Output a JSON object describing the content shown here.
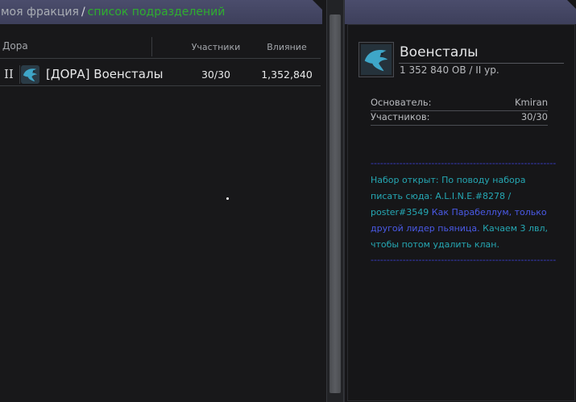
{
  "breadcrumb": {
    "faction": "моя фракция",
    "separator": "/",
    "current": "список подразделений"
  },
  "table": {
    "columns": {
      "name": "Дора",
      "members": "Участники",
      "influence": "Влияние"
    },
    "rows": [
      {
        "rank": "II",
        "emblem": "eagle-emblem",
        "name": "[ДОРА] Военсталы",
        "members": "30/30",
        "influence": "1,352,840"
      }
    ]
  },
  "clan": {
    "name": "Военсталы",
    "subtitle": "1 352 840 ОВ / II ур.",
    "emblem": "eagle-emblem",
    "founder_label": "Основатель:",
    "founder_value": "Kmiran",
    "members_label": "Участников:",
    "members_value": "30/30",
    "description": {
      "separator": "----------------------------------------------------------",
      "line1": "Набор открыт: По поводу набора",
      "line2": "писать сюда: A.L.I.N.E.#8278 /",
      "line3_part1": "poster#3549 ",
      "line3_part2": "Как Парабеллум, только",
      "line4_part1": "другой лидер пьяница. ",
      "line4_part2": "Качаем 3 лвл,",
      "line5": "чтобы потом удалить клан."
    }
  },
  "colors": {
    "header_bg": "#45475f",
    "breadcrumb_active": "#2fae2f",
    "desc_teal": "#25a8b4",
    "desc_blue": "#3a3fd0",
    "emblem_eagle": "#3ea6c8"
  }
}
